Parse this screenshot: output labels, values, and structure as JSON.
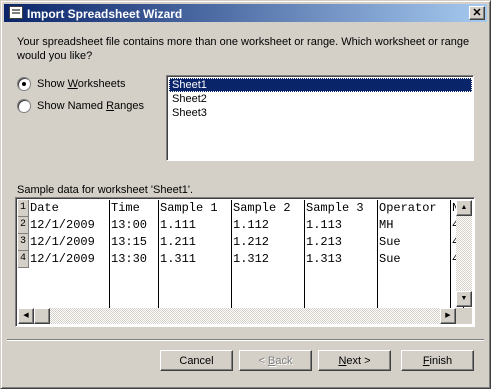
{
  "window": {
    "title": "Import Spreadsheet Wizard",
    "close_glyph": "✕"
  },
  "prompt": "Your spreadsheet file contains more than one worksheet or range. Which worksheet or range would you like?",
  "options": {
    "show_worksheets": {
      "pre": "Show ",
      "key": "W",
      "post": "orksheets",
      "selected": true
    },
    "show_named_ranges": {
      "pre": "Show Named ",
      "key": "R",
      "post": "anges",
      "selected": false
    }
  },
  "sheets": [
    {
      "label": "Sheet1",
      "selected": true
    },
    {
      "label": "Sheet2",
      "selected": false
    },
    {
      "label": "Sheet3",
      "selected": false
    }
  ],
  "sample": {
    "label": "Sample data for worksheet 'Sheet1'.",
    "row_numbers": [
      "1",
      "2",
      "3",
      "4"
    ],
    "rows": [
      [
        "Date",
        "Time",
        "Sample 1",
        "Sample 2",
        "Sample 3",
        "Operator",
        "N"
      ],
      [
        "12/1/2009",
        "13:00",
        "1.111",
        "1.112",
        "1.113",
        "MH",
        "4"
      ],
      [
        "12/1/2009",
        "13:15",
        "1.211",
        "1.212",
        "1.213",
        "Sue",
        "4"
      ],
      [
        "12/1/2009",
        "13:30",
        "1.311",
        "1.312",
        "1.313",
        "Sue",
        "4"
      ]
    ]
  },
  "buttons": {
    "cancel": "Cancel",
    "back": {
      "pre": "< ",
      "key": "B",
      "post": "ack"
    },
    "next": {
      "key": "N",
      "post": "ext >"
    },
    "finish": {
      "key": "F",
      "post": "inish"
    }
  }
}
